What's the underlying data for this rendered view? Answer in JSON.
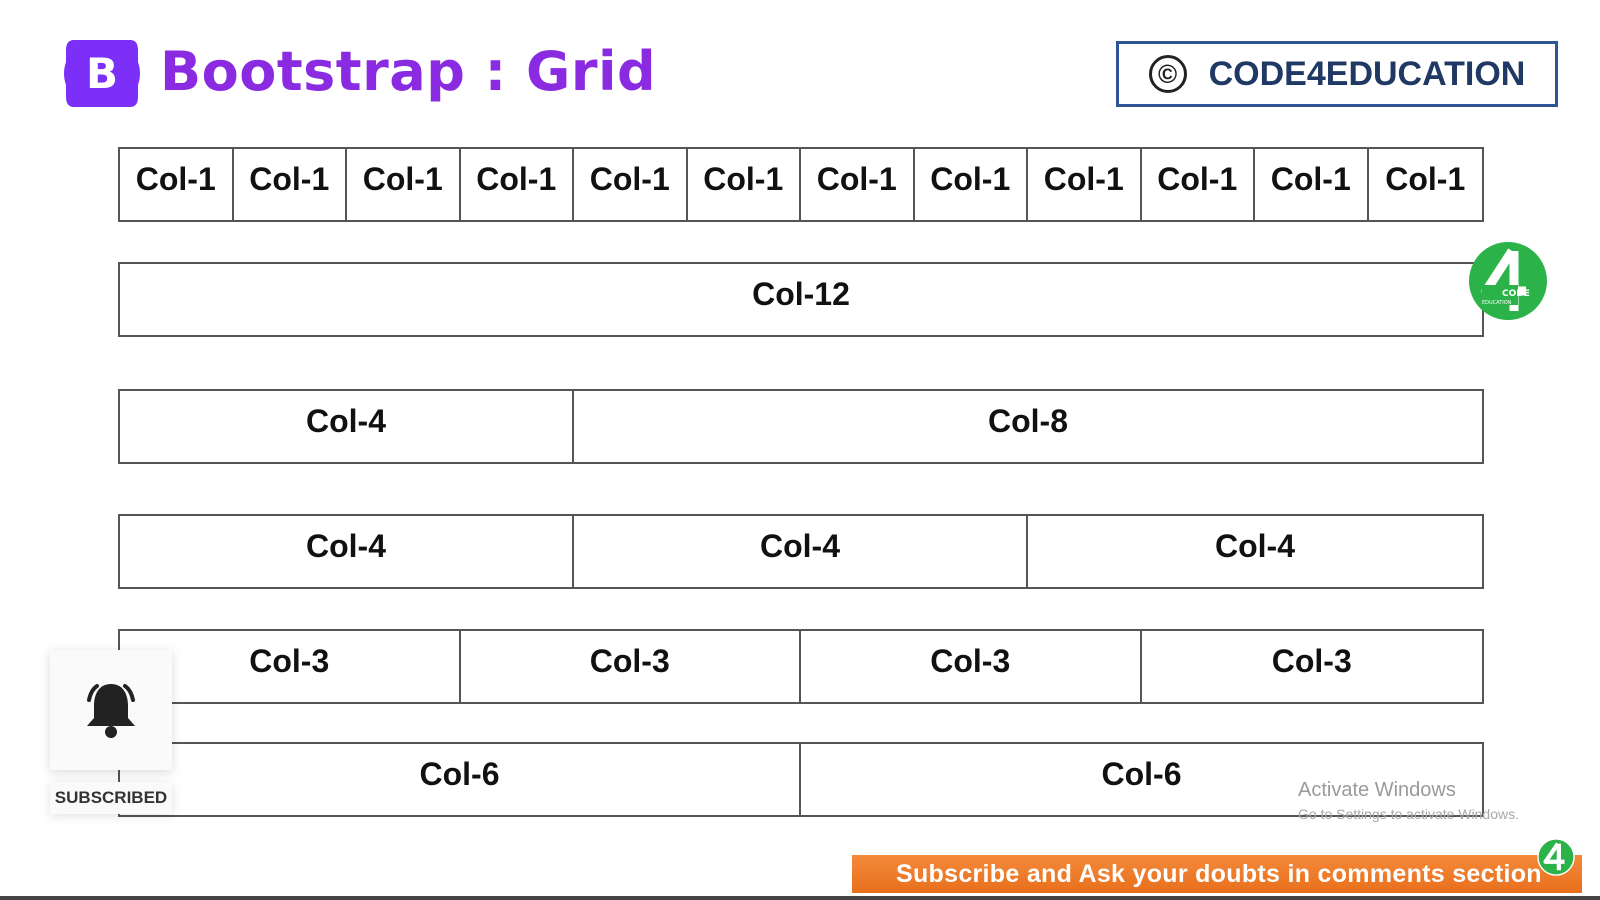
{
  "header": {
    "logo_letter": "B",
    "title": "Bootstrap : Grid",
    "copyright_symbol": "©",
    "brand": "CODE4EDUCATION",
    "colors": {
      "bootstrap_purple": "#7b2ff7",
      "title": "#8a2be2",
      "brand_border": "#2f5597",
      "brand_text": "#1f3864"
    }
  },
  "grid": {
    "rows": [
      {
        "cells": [
          {
            "label": "Col-1",
            "span": 1
          },
          {
            "label": "Col-1",
            "span": 1
          },
          {
            "label": "Col-1",
            "span": 1
          },
          {
            "label": "Col-1",
            "span": 1
          },
          {
            "label": "Col-1",
            "span": 1
          },
          {
            "label": "Col-1",
            "span": 1
          },
          {
            "label": "Col-1",
            "span": 1
          },
          {
            "label": "Col-1",
            "span": 1
          },
          {
            "label": "Col-1",
            "span": 1
          },
          {
            "label": "Col-1",
            "span": 1
          },
          {
            "label": "Col-1",
            "span": 1
          },
          {
            "label": "Col-1",
            "span": 1
          }
        ]
      },
      {
        "cells": [
          {
            "label": "Col-12",
            "span": 12
          }
        ]
      },
      {
        "cells": [
          {
            "label": "Col-4",
            "span": 4
          },
          {
            "label": "Col-8",
            "span": 8
          }
        ]
      },
      {
        "cells": [
          {
            "label": "Col-4",
            "span": 4
          },
          {
            "label": "Col-4",
            "span": 4
          },
          {
            "label": "Col-4",
            "span": 4
          }
        ]
      },
      {
        "cells": [
          {
            "label": "Col-3",
            "span": 3
          },
          {
            "label": "Col-3",
            "span": 3
          },
          {
            "label": "Col-3",
            "span": 3
          },
          {
            "label": "Col-3",
            "span": 3
          }
        ]
      },
      {
        "cells": [
          {
            "label": "Col-6",
            "span": 6
          },
          {
            "label": "Col-6",
            "span": 6
          }
        ]
      }
    ]
  },
  "badge": {
    "digit": "4",
    "line1": "CODE",
    "line2": "EDUCATION",
    "color": "#2bb34a"
  },
  "subscribe_overlay": {
    "icon": "bell-icon",
    "label": "SUBSCRIBED"
  },
  "watermark": {
    "title": "Activate Windows",
    "subtitle": "Go to Settings to activate Windows."
  },
  "banner": {
    "text": "Subscribe and Ask your doubts in comments section",
    "color": "#ee7a28"
  }
}
